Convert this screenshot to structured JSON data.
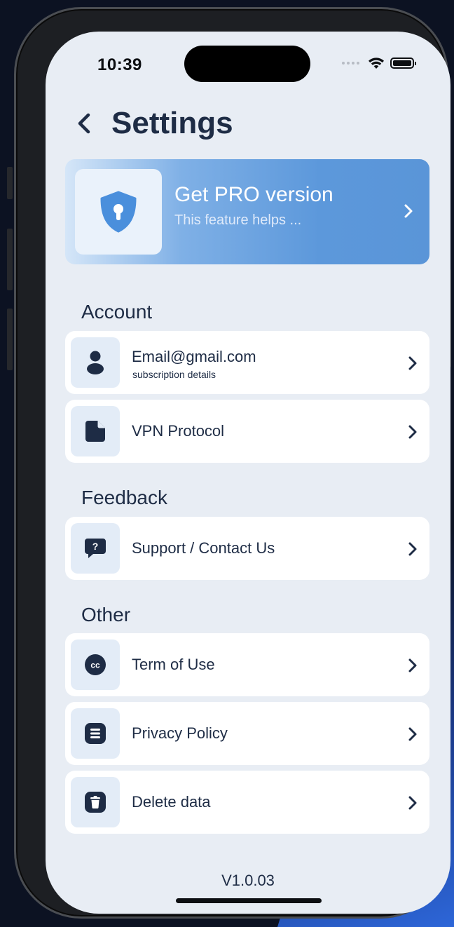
{
  "status_bar": {
    "time": "10:39"
  },
  "header": {
    "title": "Settings"
  },
  "pro_banner": {
    "title": "Get PRO version",
    "subtitle": "This feature helps ..."
  },
  "sections": {
    "account": {
      "label": "Account",
      "email": {
        "label": "Email@gmail.com",
        "sublabel": "subscription details"
      },
      "vpn_protocol": {
        "label": "VPN Protocol"
      }
    },
    "feedback": {
      "label": "Feedback",
      "support": {
        "label": "Support / Contact Us"
      }
    },
    "other": {
      "label": "Other",
      "terms": {
        "label": "Term of Use"
      },
      "privacy": {
        "label": "Privacy Policy"
      },
      "delete": {
        "label": "Delete data"
      }
    }
  },
  "footer": {
    "version": "V1.0.03"
  },
  "icons": {
    "back": "chevron-left-icon",
    "pro": "shield-keyhole-icon",
    "email": "user-icon",
    "vpn_protocol": "document-icon",
    "support": "question-chat-icon",
    "terms": "cc-icon",
    "privacy": "list-icon",
    "delete": "trash-icon",
    "chevron": "chevron-right-icon"
  },
  "colors": {
    "background": "#e8edf4",
    "text_primary": "#1e2c45",
    "accent_blue": "#5a95d8",
    "icon_box": "#e3ecf7",
    "card": "#ffffff"
  }
}
